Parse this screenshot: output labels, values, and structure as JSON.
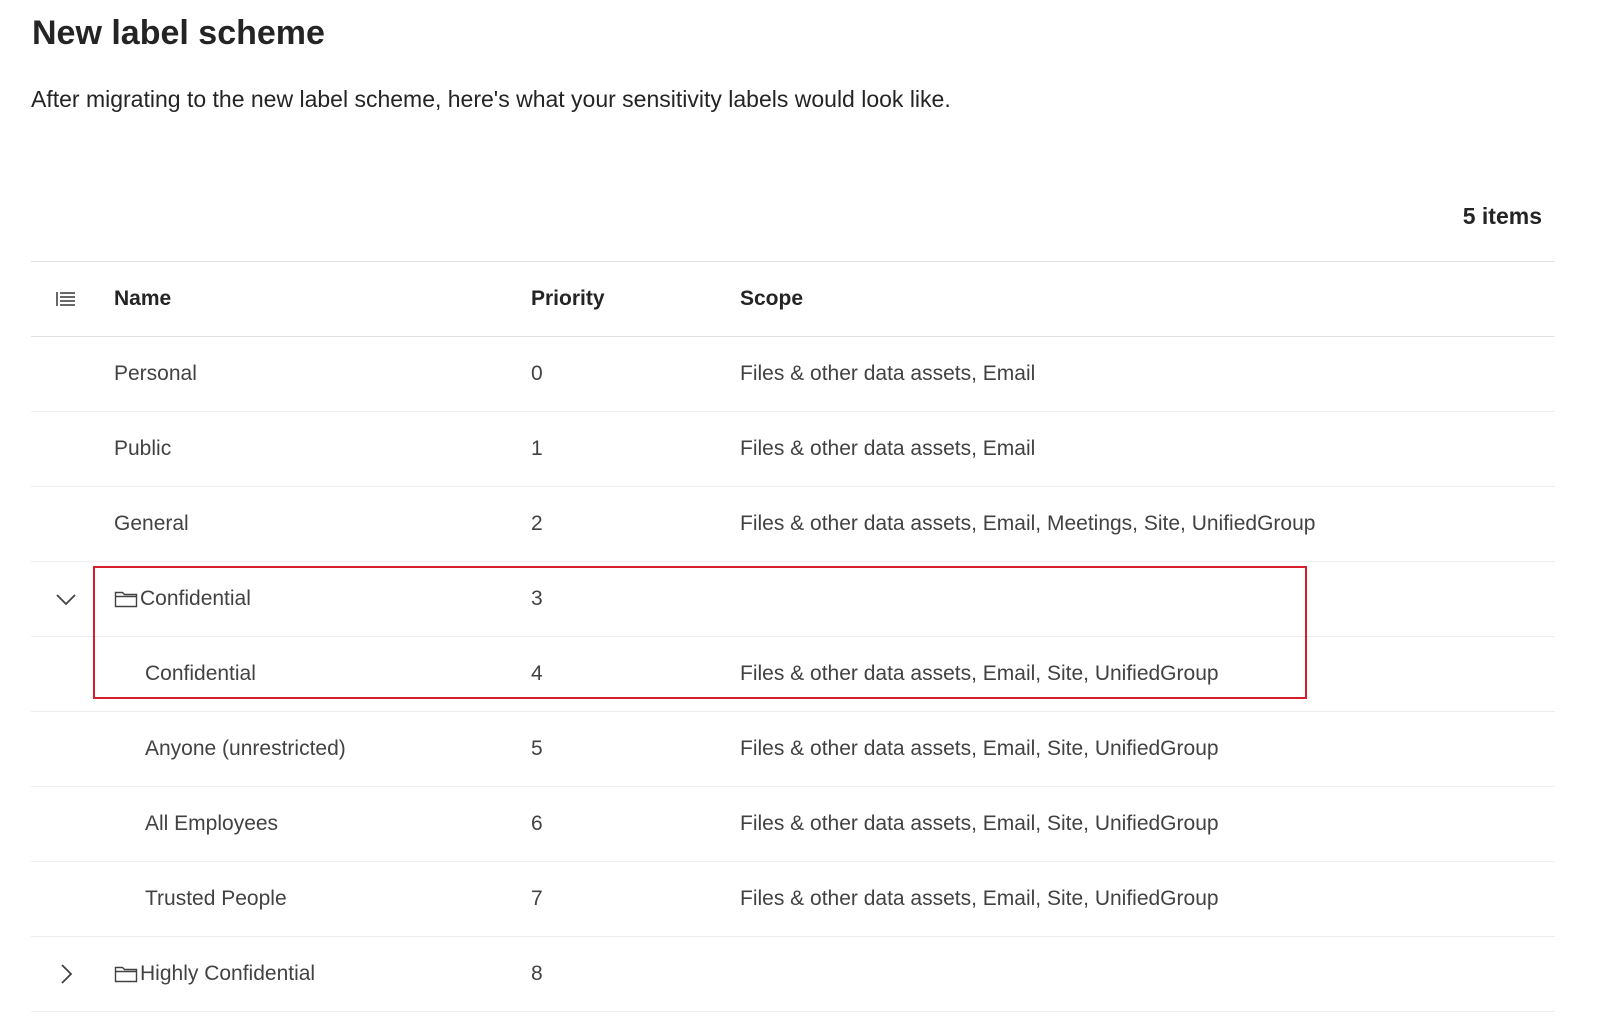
{
  "page": {
    "title": "New label scheme",
    "subtitle": "After migrating to the new label scheme, here's what your sensitivity labels would look like.",
    "item_count": "5 items"
  },
  "table": {
    "columns": {
      "name": "Name",
      "priority": "Priority",
      "scope": "Scope"
    },
    "rows": [
      {
        "name": "Personal",
        "priority": "0",
        "scope": "Files & other data assets, Email"
      },
      {
        "name": "Public",
        "priority": "1",
        "scope": "Files & other data assets, Email"
      },
      {
        "name": "General",
        "priority": "2",
        "scope": "Files & other data assets, Email, Meetings, Site, UnifiedGroup"
      },
      {
        "name": "Confidential",
        "priority": "3",
        "scope": "",
        "group": true,
        "expanded": true
      },
      {
        "name": "Confidential",
        "priority": "4",
        "scope": "Files & other data assets, Email, Site, UnifiedGroup",
        "child": true
      },
      {
        "name": "Anyone (unrestricted)",
        "priority": "5",
        "scope": "Files & other data assets, Email, Site, UnifiedGroup",
        "child": true
      },
      {
        "name": "All Employees",
        "priority": "6",
        "scope": "Files & other data assets, Email, Site, UnifiedGroup",
        "child": true
      },
      {
        "name": "Trusted People",
        "priority": "7",
        "scope": "Files & other data assets, Email, Site, UnifiedGroup",
        "child": true
      },
      {
        "name": "Highly Confidential",
        "priority": "8",
        "scope": "",
        "group": true,
        "expanded": false
      }
    ]
  },
  "icons": {
    "column_options": "list-options-icon",
    "expanded": "chevron-down-icon",
    "collapsed": "chevron-right-icon",
    "group": "folder-icon"
  },
  "colors": {
    "highlight": "#d71e2b",
    "text": "#242424",
    "secondary_text": "#424242"
  }
}
